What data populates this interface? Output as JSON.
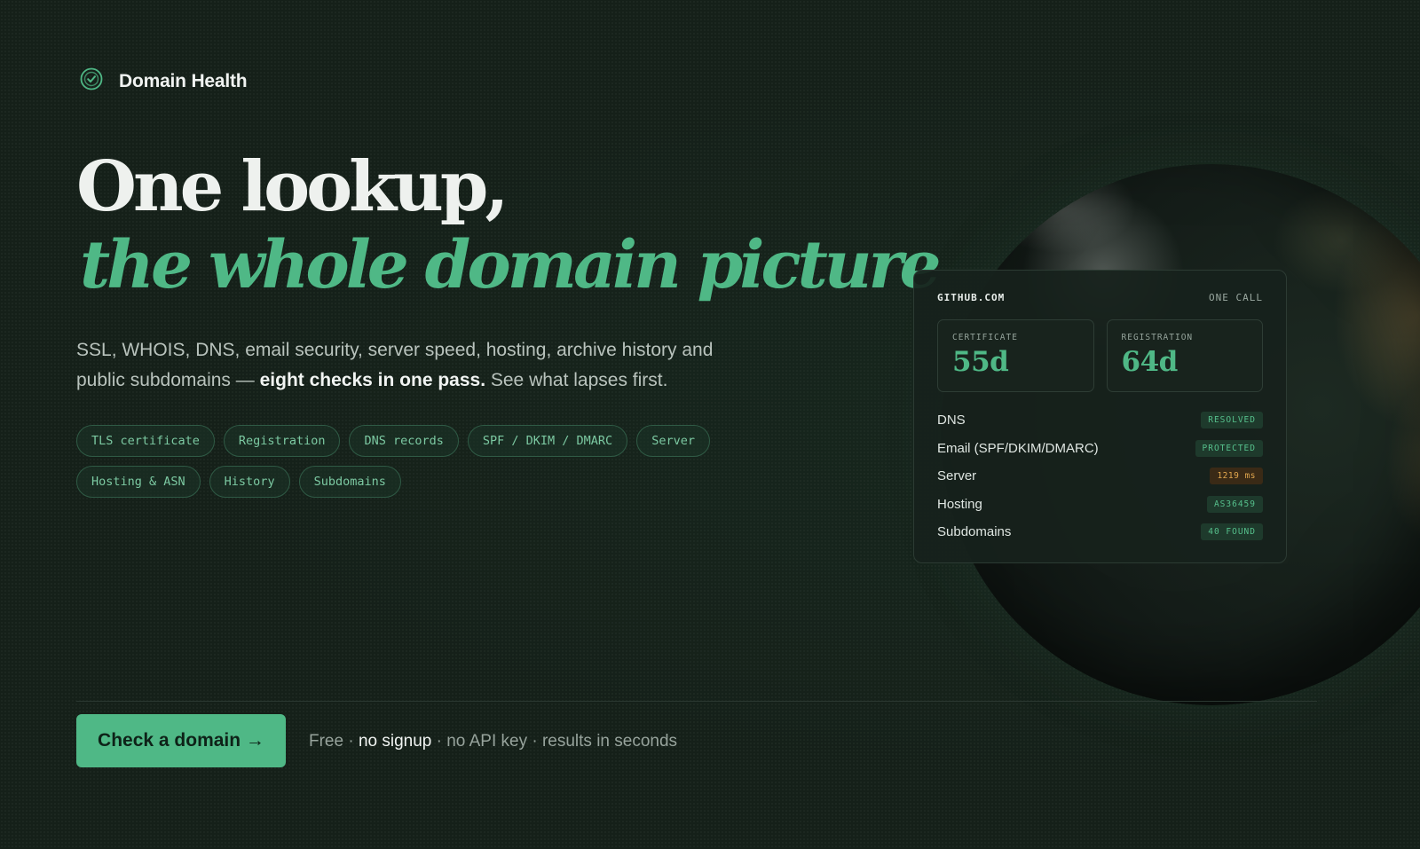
{
  "brand": {
    "name": "Domain Health",
    "icon": "check-circle-icon"
  },
  "hero": {
    "line1": "One lookup,",
    "line2": "the whole domain picture",
    "lede_pre": "SSL, WHOIS, DNS, email security, server speed, hosting, archive history and public subdomains — ",
    "lede_strong": "eight checks in one pass.",
    "lede_post": " See what lapses first."
  },
  "chips": [
    "TLS certificate",
    "Registration",
    "DNS records",
    "SPF / DKIM / DMARC",
    "Server",
    "Hosting & ASN",
    "History",
    "Subdomains"
  ],
  "card": {
    "domain": "GITHUB.COM",
    "tag": "ONE CALL",
    "stats": [
      {
        "label": "CERTIFICATE",
        "value": "55d"
      },
      {
        "label": "REGISTRATION",
        "value": "64d"
      }
    ],
    "rows": [
      {
        "label": "DNS",
        "badge": "RESOLVED",
        "status": "ok"
      },
      {
        "label": "Email (SPF/DKIM/DMARC)",
        "badge": "PROTECTED",
        "status": "ok"
      },
      {
        "label": "Server",
        "badge": "1219 ms",
        "status": "warn"
      },
      {
        "label": "Hosting",
        "badge": "AS36459",
        "status": "ok"
      },
      {
        "label": "Subdomains",
        "badge": "40 FOUND",
        "status": "ok"
      }
    ]
  },
  "cta": {
    "button": "Check a domain →",
    "note_a": "Free · ",
    "note_b": "no signup",
    "note_c": " · no API key · results in seconds"
  },
  "colors": {
    "accent": "#4fb886",
    "background": "#152019",
    "warn": "#e0a64e"
  }
}
